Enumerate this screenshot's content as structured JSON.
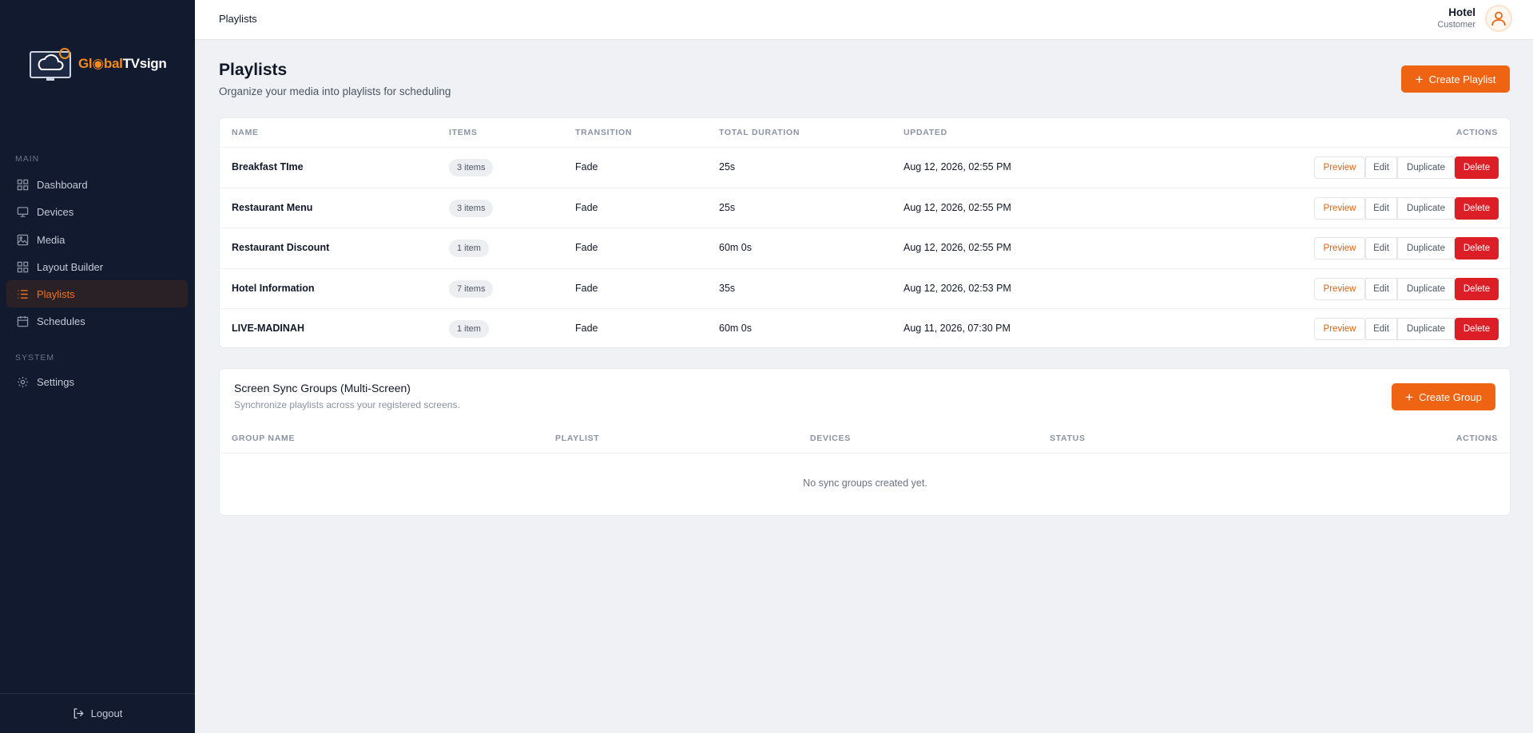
{
  "sidebar": {
    "logo": {
      "part1": "Gl",
      "part2": "bal",
      "part3": "TVsign"
    },
    "sections": {
      "main": "MAIN",
      "system": "SYSTEM"
    },
    "items": [
      {
        "label": "Dashboard",
        "icon": "grid-icon"
      },
      {
        "label": "Devices",
        "icon": "monitor-icon"
      },
      {
        "label": "Media",
        "icon": "image-icon"
      },
      {
        "label": "Layout Builder",
        "icon": "layout-icon"
      },
      {
        "label": "Playlists",
        "icon": "list-icon",
        "active": true
      },
      {
        "label": "Schedules",
        "icon": "calendar-icon"
      },
      {
        "label": "Settings",
        "icon": "gear-icon"
      }
    ],
    "logout": "Logout"
  },
  "topbar": {
    "breadcrumb": "Playlists",
    "user": {
      "name": "Hotel",
      "role": "Customer"
    }
  },
  "page": {
    "title": "Playlists",
    "subtitle": "Organize your media into playlists for scheduling",
    "create_button": "Create Playlist"
  },
  "playlists": {
    "columns": {
      "name": "NAME",
      "items": "ITEMS",
      "transition": "TRANSITION",
      "duration": "TOTAL DURATION",
      "updated": "UPDATED",
      "actions": "ACTIONS"
    },
    "action_labels": {
      "preview": "Preview",
      "edit": "Edit",
      "duplicate": "Duplicate",
      "delete": "Delete"
    },
    "rows": [
      {
        "name": "Breakfast TIme",
        "items": "3 items",
        "transition": "Fade",
        "duration": "25s",
        "updated": "Aug 12, 2026, 02:55 PM"
      },
      {
        "name": "Restaurant Menu",
        "items": "3 items",
        "transition": "Fade",
        "duration": "25s",
        "updated": "Aug 12, 2026, 02:55 PM"
      },
      {
        "name": "Restaurant Discount",
        "items": "1 item",
        "transition": "Fade",
        "duration": "60m 0s",
        "updated": "Aug 12, 2026, 02:55 PM"
      },
      {
        "name": "Hotel Information",
        "items": "7 items",
        "transition": "Fade",
        "duration": "35s",
        "updated": "Aug 12, 2026, 02:53 PM"
      },
      {
        "name": "LIVE-MADINAH",
        "items": "1 item",
        "transition": "Fade",
        "duration": "60m 0s",
        "updated": "Aug 11, 2026, 07:30 PM"
      }
    ]
  },
  "sync": {
    "title": "Screen Sync Groups (Multi-Screen)",
    "subtitle": "Synchronize playlists across your registered screens.",
    "create_button": "Create Group",
    "columns": {
      "group": "GROUP NAME",
      "playlist": "PLAYLIST",
      "devices": "DEVICES",
      "status": "STATUS",
      "actions": "ACTIONS"
    },
    "empty": "No sync groups created yet."
  },
  "colors": {
    "accent": "#ef6412",
    "danger": "#dc1f26",
    "sidebar_bg": "#111a2e"
  }
}
